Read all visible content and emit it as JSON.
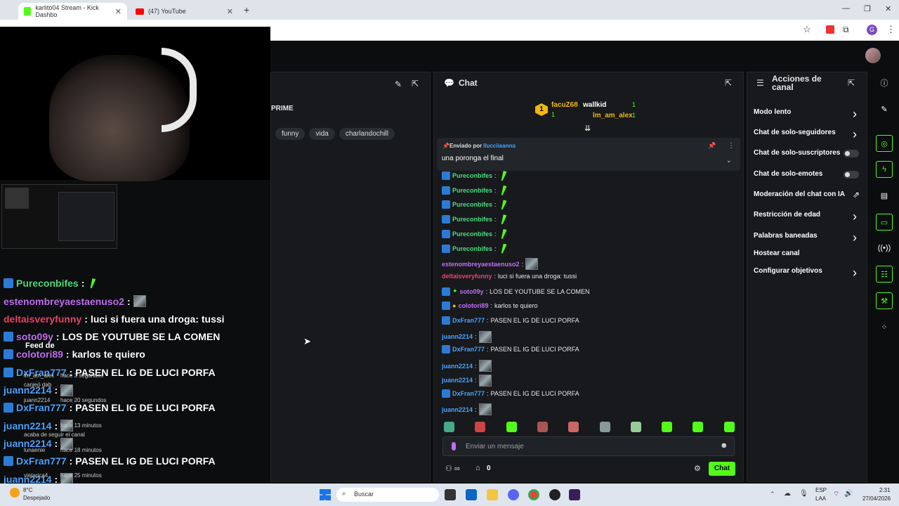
{
  "browser": {
    "tabs": [
      {
        "title": "karlito04 Stream - Kick Dashbo"
      },
      {
        "title": "(47) YouTube"
      }
    ],
    "new_tab": "+"
  },
  "stream_panel": {
    "title_fragment": "PRIME",
    "tags": [
      "funny",
      "vida",
      "charlandochill"
    ]
  },
  "chat": {
    "title": "Chat",
    "leaderboard": [
      {
        "name": "facuZ68",
        "count": "1",
        "rank": "1"
      },
      {
        "name": "wallkid",
        "count": "1"
      },
      {
        "name": "lm_am_alex",
        "count": "1"
      }
    ],
    "pinned": {
      "label": "Enviado por",
      "author": "llucciiaanna",
      "text": "una poronga el final"
    },
    "messages": [
      {
        "user": "Pureconbifes",
        "text": "",
        "color": "g",
        "type": "feather"
      },
      {
        "user": "Pureconbifes",
        "text": "",
        "color": "g",
        "type": "feather"
      },
      {
        "user": "Pureconbifes",
        "text": "",
        "color": "g",
        "type": "feather"
      },
      {
        "user": "Pureconbifes",
        "text": "",
        "color": "g",
        "type": "feather"
      },
      {
        "user": "Pureconbifes",
        "text": "",
        "color": "g",
        "type": "feather"
      },
      {
        "user": "Pureconbifes",
        "text": "",
        "color": "g",
        "type": "feather"
      },
      {
        "user": "estenombreyaestaenuso2",
        "text": "",
        "color": "p",
        "type": "thumb"
      },
      {
        "user": "deltaisveryfunny",
        "text": "luci si fuera una droga: tussi",
        "color": "r",
        "type": "text"
      },
      {
        "user": "soto09y",
        "text": "LOS DE YOUTUBE SE LA COMEN",
        "color": "p",
        "type": "text"
      },
      {
        "user": "colotori89",
        "text": "karlos te quiero",
        "color": "p",
        "type": "text"
      },
      {
        "user": "DxFran777",
        "text": "PASEN EL IG DE LUCI PORFA",
        "color": "b",
        "type": "text"
      },
      {
        "user": "juann2214",
        "text": "",
        "color": "b",
        "type": "thumb"
      },
      {
        "user": "DxFran777",
        "text": "PASEN EL IG DE LUCI PORFA",
        "color": "b",
        "type": "text"
      },
      {
        "user": "juann2214",
        "text": "",
        "color": "b",
        "type": "thumb"
      },
      {
        "user": "juann2214",
        "text": "",
        "color": "b",
        "type": "thumb"
      },
      {
        "user": "DxFran777",
        "text": "PASEN EL IG DE LUCI PORFA",
        "color": "b",
        "type": "text"
      },
      {
        "user": "juann2214",
        "text": "",
        "color": "b",
        "type": "thumb"
      }
    ],
    "input_placeholder": "Enviar un mensaje",
    "points": "0",
    "send_label": "Chat"
  },
  "actions": {
    "title": "Acciones de canal",
    "items": [
      {
        "label": "Modo lento",
        "control": "chevron"
      },
      {
        "label": "Chat de solo-seguidores",
        "control": "chevron"
      },
      {
        "label": "Chat de solo-suscriptores",
        "control": "toggle"
      },
      {
        "label": "Chat de solo-emotes",
        "control": "toggle"
      },
      {
        "label": "Moderación del chat con IA",
        "control": "external"
      },
      {
        "label": "Restricción de edad",
        "control": "chevron"
      },
      {
        "label": "Palabras baneadas",
        "control": "chevron"
      },
      {
        "label": "Hostear canal",
        "control": "none"
      },
      {
        "label": "Configurar objetivos",
        "control": "chevron"
      }
    ]
  },
  "overlay": {
    "lines": [
      {
        "user": "Pureconbifes",
        "sep": ":",
        "text": ""
      },
      {
        "user": "estenombreyaestaenuso2",
        "sep": ":",
        "text": ""
      },
      {
        "user": "deltaisveryfunny",
        "sep": ":",
        "text": "luci si fuera una droga: tussi"
      },
      {
        "user": "soto09y",
        "sep": ":",
        "text": "LOS DE YOUTUBE SE LA COMEN"
      },
      {
        "user": "colotori89",
        "sep": ":",
        "text": "karlos te quiero"
      },
      {
        "user": "DxFran777",
        "sep": ":",
        "text": "PASEN EL IG DE LUCI PORFA"
      },
      {
        "user": "juann2214",
        "sep": ":",
        "text": ""
      },
      {
        "user": "DxFran777",
        "sep": ":",
        "text": "PASEN EL IG DE LUCI PORFA"
      },
      {
        "user": "juann2214",
        "sep": ":",
        "text": ""
      },
      {
        "user": "juann2214",
        "sep": ":",
        "text": ""
      },
      {
        "user": "DxFran777",
        "sep": ":",
        "text": "PASEN EL IG DE LUCI PORFA"
      },
      {
        "user": "juann2214",
        "sep": ":",
        "text": ""
      }
    ],
    "feed_title": "Feed de",
    "feed": [
      {
        "text": "lm_am_alex",
        "time": "hace 3 segundos"
      },
      {
        "text": "canjeó dab",
        "time": ""
      },
      {
        "text": "juann2214",
        "time": "hace 20 segundos"
      },
      {
        "text": "",
        "time": "hace 13 minutos"
      },
      {
        "text": "acaba de seguir el canal",
        "time": ""
      },
      {
        "text": "lunaenie",
        "time": "hace 18 minutos"
      },
      {
        "text": "vietarica4",
        "time": "hace 25 minutos"
      }
    ]
  },
  "taskbar": {
    "weather_temp": "8°C",
    "weather_desc": "Despejado",
    "search": "Buscar",
    "lang": "ESP",
    "lang2": "LAA",
    "time": "2:31",
    "date": "27/04/2026"
  },
  "colors": {
    "kick_green": "#53fc18",
    "panel": "#17191c",
    "background": "#0b0d0e"
  }
}
